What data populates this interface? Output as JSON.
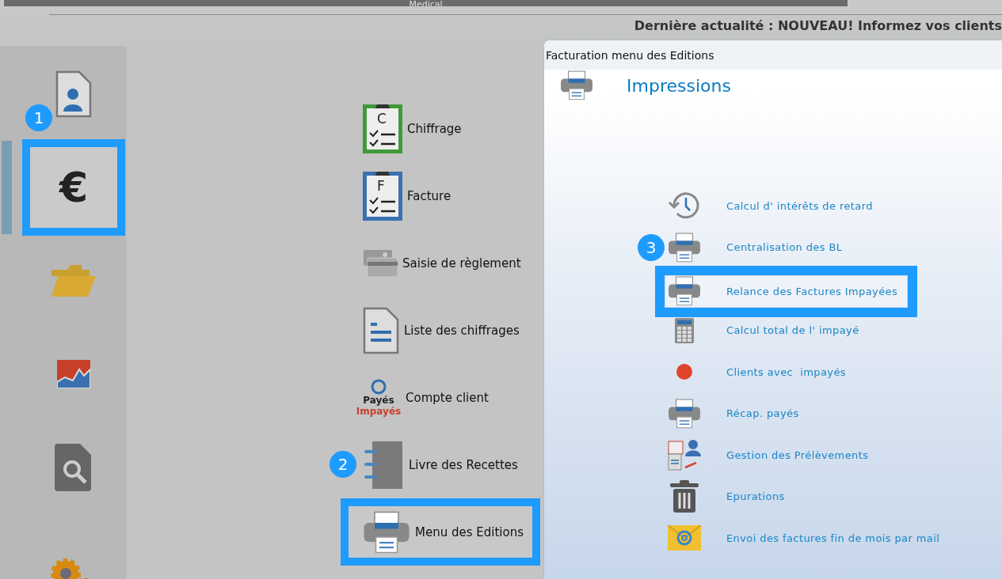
{
  "top_bar": {
    "title": "Medical"
  },
  "news": "Dernière actualité : NOUVEAU! Informez vos clients",
  "sidebar": {
    "items": [
      {
        "kind": "contact",
        "selected": false,
        "highlighted": false,
        "badge": "1"
      },
      {
        "kind": "euro",
        "symbol": "€",
        "selected": true,
        "highlighted": true
      },
      {
        "kind": "folder",
        "selected": false,
        "highlighted": false
      },
      {
        "kind": "chart",
        "selected": false,
        "highlighted": false
      },
      {
        "kind": "search",
        "selected": false,
        "highlighted": false
      },
      {
        "kind": "gears",
        "selected": false,
        "highlighted": false
      }
    ]
  },
  "menu": {
    "items": [
      {
        "kind": "clipboard",
        "letter": "C",
        "color": "#3f9a3a",
        "label": "Chiffrage",
        "highlighted": false
      },
      {
        "kind": "clipboard",
        "letter": "F",
        "color": "#3a70b0",
        "label": "Facture",
        "highlighted": false
      },
      {
        "kind": "card",
        "label": "Saisie de règlement",
        "highlighted": false
      },
      {
        "kind": "document",
        "label": "Liste des chiffrages",
        "highlighted": false
      },
      {
        "kind": "paid",
        "paid": "Payés",
        "unpaid": "Impayés",
        "label": "Compte client",
        "highlighted": false
      },
      {
        "kind": "notebook",
        "label": "Livre des Recettes",
        "highlighted": false,
        "badge": "2"
      },
      {
        "kind": "printer",
        "label": "Menu des Editions",
        "highlighted": true
      }
    ]
  },
  "dialog": {
    "title": "Facturation menu des Editions",
    "heading": "Impressions",
    "items": [
      {
        "kind": "clock",
        "label": "Calcul d' intérêts de retard",
        "highlighted": false
      },
      {
        "kind": "printer",
        "label": "Centralisation des BL",
        "highlighted": false,
        "badge": "3"
      },
      {
        "kind": "printer",
        "label": "Relance des Factures Impayées",
        "highlighted": true
      },
      {
        "kind": "calculator",
        "label": "Calcul total de l' impayé",
        "highlighted": false
      },
      {
        "kind": "dot",
        "label": "Clients avec  impayés",
        "highlighted": false
      },
      {
        "kind": "printer",
        "label": "Récap. payés",
        "highlighted": false
      },
      {
        "kind": "calendar",
        "label": "Gestion des Prélèvements",
        "highlighted": false
      },
      {
        "kind": "trash",
        "label": "Epurations",
        "highlighted": false
      },
      {
        "kind": "mail",
        "label": "Envoi des factures fin de mois par mail",
        "highlighted": false
      }
    ]
  }
}
